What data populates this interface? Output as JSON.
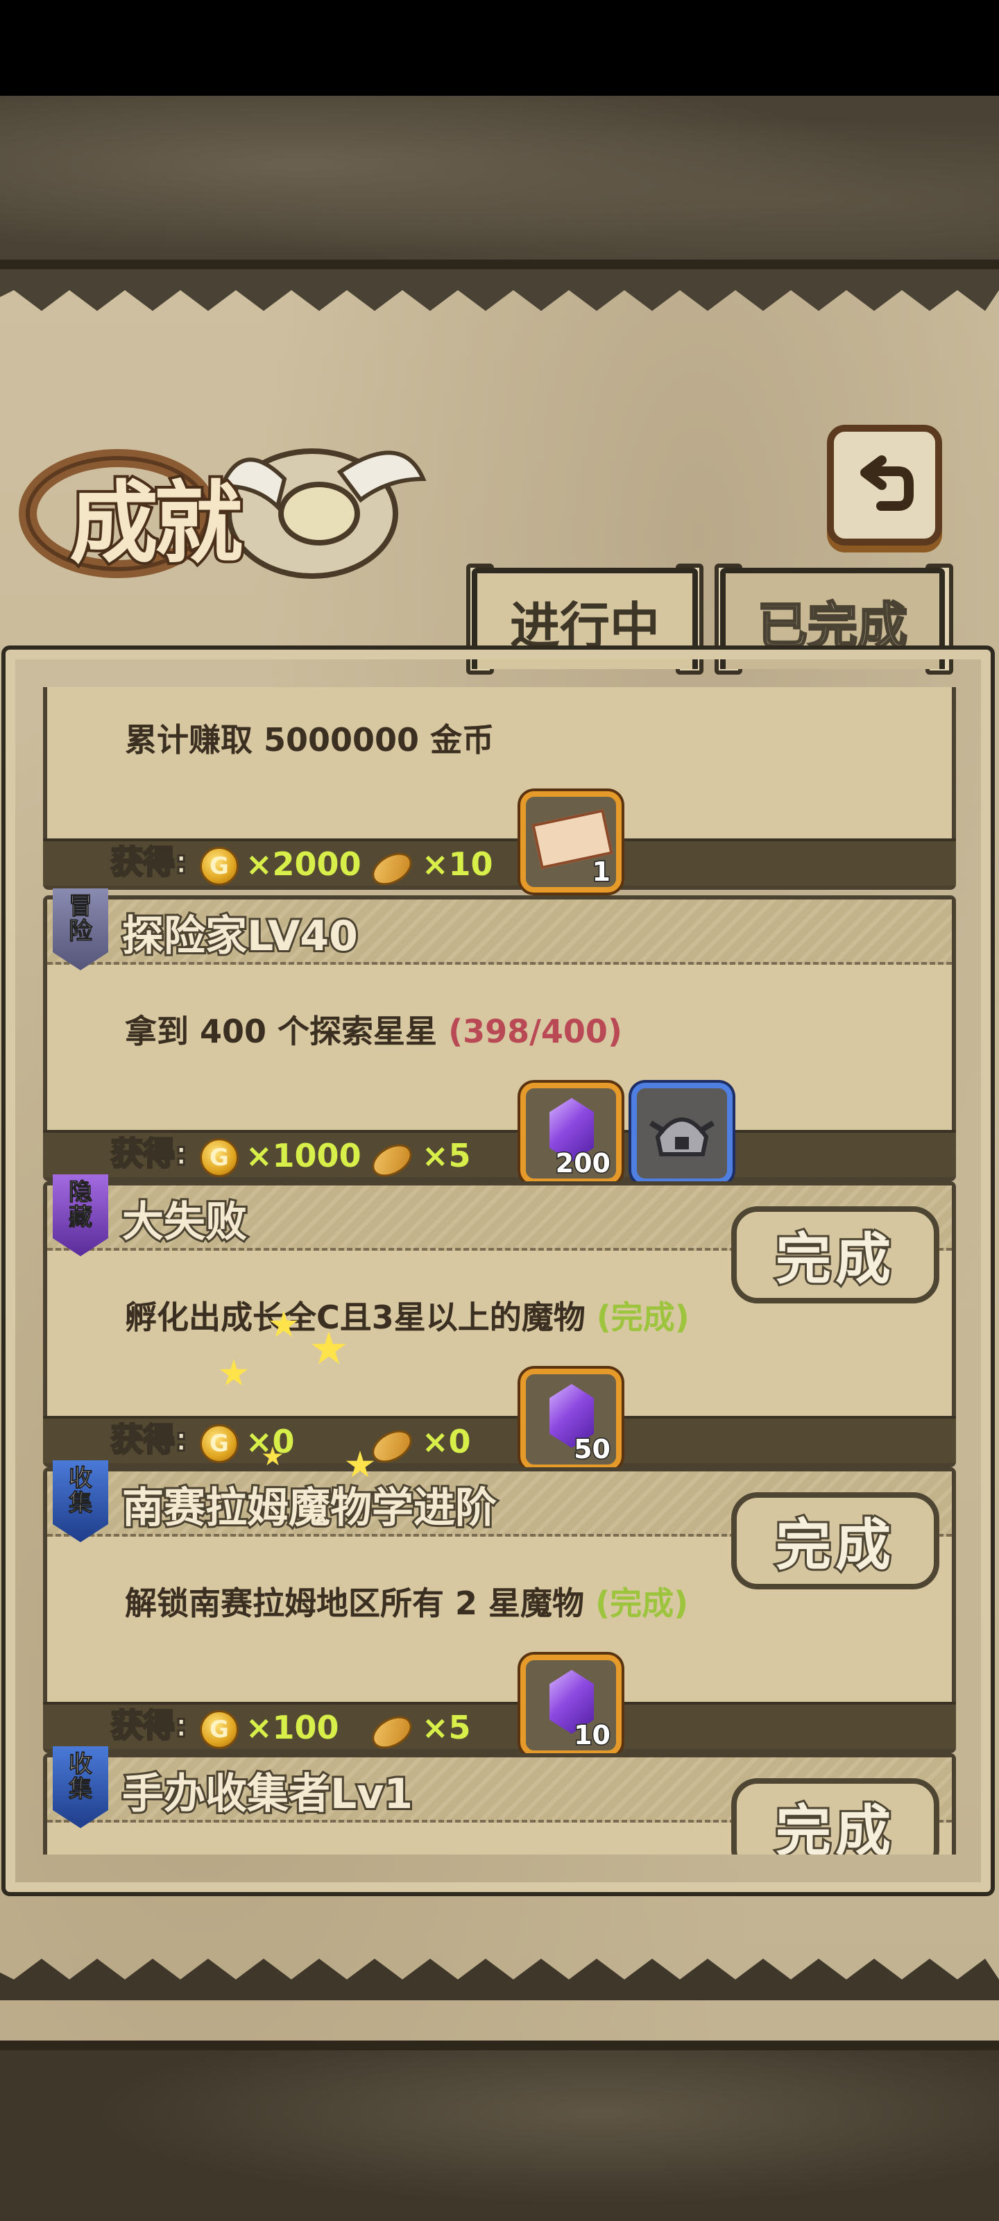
{
  "header": {
    "title": "成就",
    "back_icon": "back-arrow-icon"
  },
  "tabs": [
    {
      "label": "进行中",
      "active": true
    },
    {
      "label": "已完成",
      "active": false
    }
  ],
  "reward_label": "获得:",
  "coin_glyph": "G",
  "achievements": [
    {
      "name": "",
      "description": "累计赚取 5000000 金币",
      "progress": "",
      "rewards": {
        "coins": "×2000",
        "bread": "×10"
      },
      "items": [
        {
          "type": "ticket",
          "count": "1"
        }
      ]
    },
    {
      "ribbon": "冒险",
      "name": "探险家LV40",
      "description": "拿到 400 个探索星星",
      "progress": "(398/400)",
      "rewards": {
        "coins": "×1000",
        "bread": "×5"
      },
      "items": [
        {
          "type": "gem",
          "count": "200"
        },
        {
          "type": "helmet",
          "count": ""
        }
      ]
    },
    {
      "ribbon": "隐藏",
      "name": "大失败",
      "description": "孵化出成长全C且3星以上的魔物",
      "progress": "(完成)",
      "complete_label": "完成",
      "rewards": {
        "coins": "×0",
        "bread": "×0"
      },
      "items": [
        {
          "type": "gem",
          "count": "50"
        }
      ]
    },
    {
      "ribbon": "收集",
      "name": "南赛拉姆魔物学进阶",
      "description": "解锁南赛拉姆地区所有 2 星魔物",
      "progress": "(完成)",
      "complete_label": "完成",
      "rewards": {
        "coins": "×100",
        "bread": "×5"
      },
      "items": [
        {
          "type": "gem",
          "count": "10"
        }
      ]
    },
    {
      "ribbon": "收集",
      "name": "手办收集者Lv1",
      "complete_label": "完成"
    }
  ],
  "colors": {
    "parchment": "#cdbf9f",
    "reward_bar": "#544a33",
    "quantity": "#d8ef4a",
    "progress": "#b94a55",
    "done": "#9cc43c",
    "item_border": "#e59a2a",
    "item_border_blue": "#4f7fe0"
  }
}
